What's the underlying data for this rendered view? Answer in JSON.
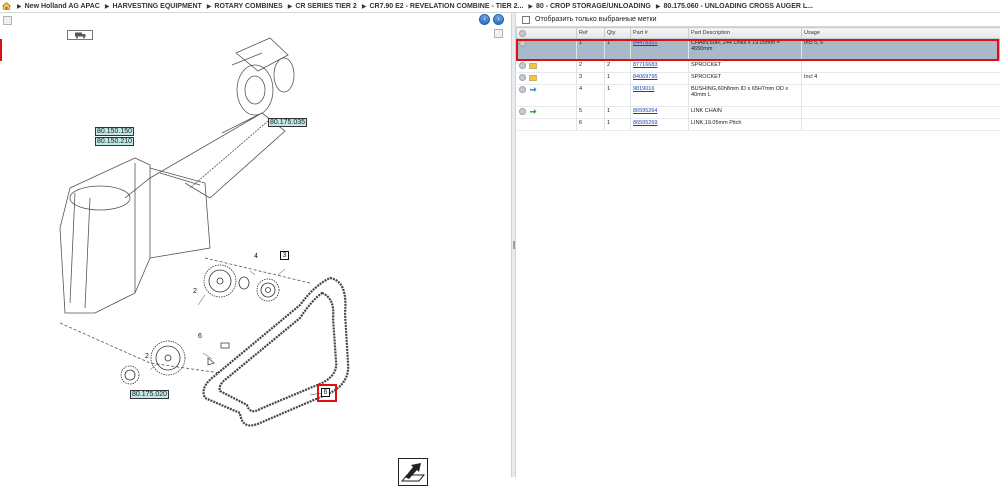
{
  "breadcrumb": {
    "items": [
      "New Holland AG APAC",
      "HARVESTING EQUIPMENT",
      "ROTARY COMBINES",
      "CR SERIES TIER 2",
      "CR7.90 E2 - REVELATION COMBINE - TIER 2...",
      "80 - CROP STORAGE/UNLOADING",
      "80.175.060 - UNLOADING CROSS AUGER L..."
    ]
  },
  "diagram": {
    "ref_labels": [
      "80.150.150",
      "80.150.210",
      "80.175.035",
      "80.175.020"
    ],
    "callouts": [
      "2",
      "3",
      "4",
      "2",
      "6",
      "6"
    ]
  },
  "filter": {
    "label": "Отобразить только выбранные метки"
  },
  "table": {
    "headers": [
      "",
      "Ref",
      "Qty",
      "Part #",
      "Part Description",
      "Usage"
    ],
    "rows": [
      {
        "ref": "1",
        "qty": "1",
        "part": "84478351",
        "desc": "CHAIN,60H, 244 Links x 19.05mm = 4650mm",
        "usage": "Incl 5, 6"
      },
      {
        "ref": "2",
        "qty": "2",
        "part": "87716683",
        "desc": "SPROCKET",
        "usage": ""
      },
      {
        "ref": "3",
        "qty": "1",
        "part": "84069795",
        "desc": "SPROCKET",
        "usage": "Incl 4"
      },
      {
        "ref": "4",
        "qty": "1",
        "part": "9819016",
        "desc": "BUSHING,60h8mm ID x 65H7mm OD x 40mm L",
        "usage": ""
      },
      {
        "ref": "5",
        "qty": "1",
        "part": "86595264",
        "desc": "LINK CHAIN",
        "usage": ""
      },
      {
        "ref": "6",
        "qty": "1",
        "part": "86595269",
        "desc": "LINK,19.05mm Pitch",
        "usage": ""
      }
    ]
  },
  "colors": {
    "highlight": "#d11111",
    "link": "#1a3fb5",
    "selected_row": "#aab9c9",
    "ref_label_bg": "#bfe8e8"
  }
}
